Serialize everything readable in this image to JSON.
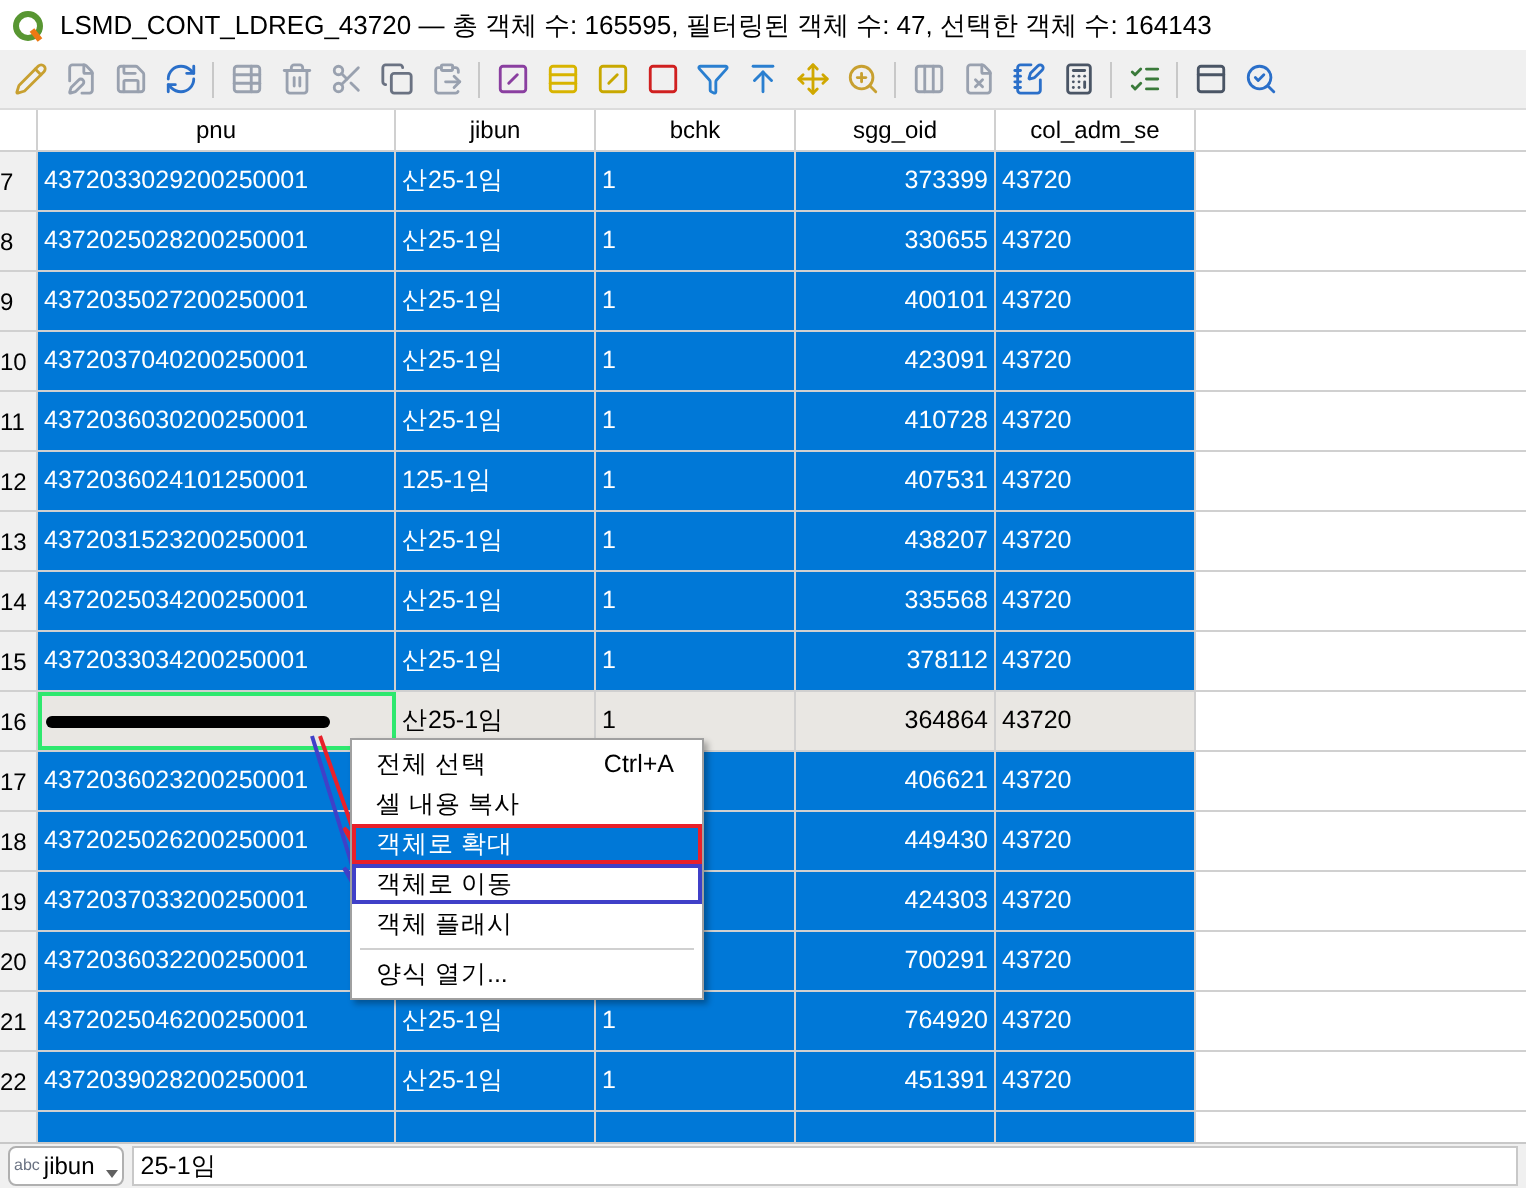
{
  "window": {
    "title": "LSMD_CONT_LDREG_43720 — 총 객체 수: 165595, 필터링된 객체 수: 47, 선택한 객체 수: 164143"
  },
  "table": {
    "columns": [
      "pnu",
      "jibun",
      "bchk",
      "sgg_oid",
      "col_adm_se"
    ],
    "rows": [
      {
        "num": "7",
        "pnu": "4372033029200250001",
        "jibun": "산25-1임",
        "bchk": "1",
        "sgg_oid": "373399",
        "col_adm_se": "43720",
        "selected": true,
        "current": false
      },
      {
        "num": "8",
        "pnu": "4372025028200250001",
        "jibun": "산25-1임",
        "bchk": "1",
        "sgg_oid": "330655",
        "col_adm_se": "43720",
        "selected": true,
        "current": false
      },
      {
        "num": "9",
        "pnu": "4372035027200250001",
        "jibun": "산25-1임",
        "bchk": "1",
        "sgg_oid": "400101",
        "col_adm_se": "43720",
        "selected": true,
        "current": false
      },
      {
        "num": "10",
        "pnu": "4372037040200250001",
        "jibun": "산25-1임",
        "bchk": "1",
        "sgg_oid": "423091",
        "col_adm_se": "43720",
        "selected": true,
        "current": false
      },
      {
        "num": "11",
        "pnu": "4372036030200250001",
        "jibun": "산25-1임",
        "bchk": "1",
        "sgg_oid": "410728",
        "col_adm_se": "43720",
        "selected": true,
        "current": false
      },
      {
        "num": "12",
        "pnu": "4372036024101250001",
        "jibun": "125-1임",
        "bchk": "1",
        "sgg_oid": "407531",
        "col_adm_se": "43720",
        "selected": true,
        "current": false
      },
      {
        "num": "13",
        "pnu": "4372031523200250001",
        "jibun": "산25-1임",
        "bchk": "1",
        "sgg_oid": "438207",
        "col_adm_se": "43720",
        "selected": true,
        "current": false
      },
      {
        "num": "14",
        "pnu": "4372025034200250001",
        "jibun": "산25-1임",
        "bchk": "1",
        "sgg_oid": "335568",
        "col_adm_se": "43720",
        "selected": true,
        "current": false
      },
      {
        "num": "15",
        "pnu": "4372033034200250001",
        "jibun": "산25-1임",
        "bchk": "1",
        "sgg_oid": "378112",
        "col_adm_se": "43720",
        "selected": true,
        "current": false
      },
      {
        "num": "16",
        "redacted": true,
        "jibun": "산25-1임",
        "bchk": "1",
        "sgg_oid": "364864",
        "col_adm_se": "43720",
        "selected": false,
        "current": true
      },
      {
        "num": "17",
        "pnu": "4372036023200250001",
        "sgg_oid": "406621",
        "col_adm_se": "43720",
        "selected": true,
        "current": false
      },
      {
        "num": "18",
        "pnu": "4372025026200250001",
        "sgg_oid": "449430",
        "col_adm_se": "43720",
        "selected": true,
        "current": false
      },
      {
        "num": "19",
        "pnu": "4372037033200250001",
        "sgg_oid": "424303",
        "col_adm_se": "43720",
        "selected": true,
        "current": false
      },
      {
        "num": "20",
        "pnu": "4372036032200250001",
        "sgg_oid": "700291",
        "col_adm_se": "43720",
        "selected": true,
        "current": false
      },
      {
        "num": "21",
        "pnu": "4372025046200250001",
        "jibun": "산25-1임",
        "bchk": "1",
        "sgg_oid": "764920",
        "col_adm_se": "43720",
        "selected": true,
        "current": false
      },
      {
        "num": "22",
        "pnu": "4372039028200250001",
        "jibun": "산25-1임",
        "bchk": "1",
        "sgg_oid": "451391",
        "col_adm_se": "43720",
        "selected": true,
        "current": false
      },
      {
        "selected": true,
        "current": false
      }
    ]
  },
  "context_menu": {
    "items": [
      {
        "kind": "item",
        "label": "전체 선택",
        "shortcut": "Ctrl+A",
        "highlighted": false
      },
      {
        "kind": "item",
        "label": "셀 내용 복사",
        "highlighted": false
      },
      {
        "kind": "item",
        "label": "객체로 확대",
        "highlighted": true,
        "color": "#e8202a"
      },
      {
        "kind": "item",
        "label": "객체로 이동",
        "highlighted": false,
        "color": "#4040c8"
      },
      {
        "kind": "item",
        "label": "객체 플래시",
        "highlighted": false
      },
      {
        "kind": "separator"
      },
      {
        "kind": "item",
        "label": "양식 열기...",
        "highlighted": false
      }
    ]
  },
  "bottom_bar": {
    "field_type": "abc",
    "field_name": "jibun",
    "value": "25-1임"
  }
}
